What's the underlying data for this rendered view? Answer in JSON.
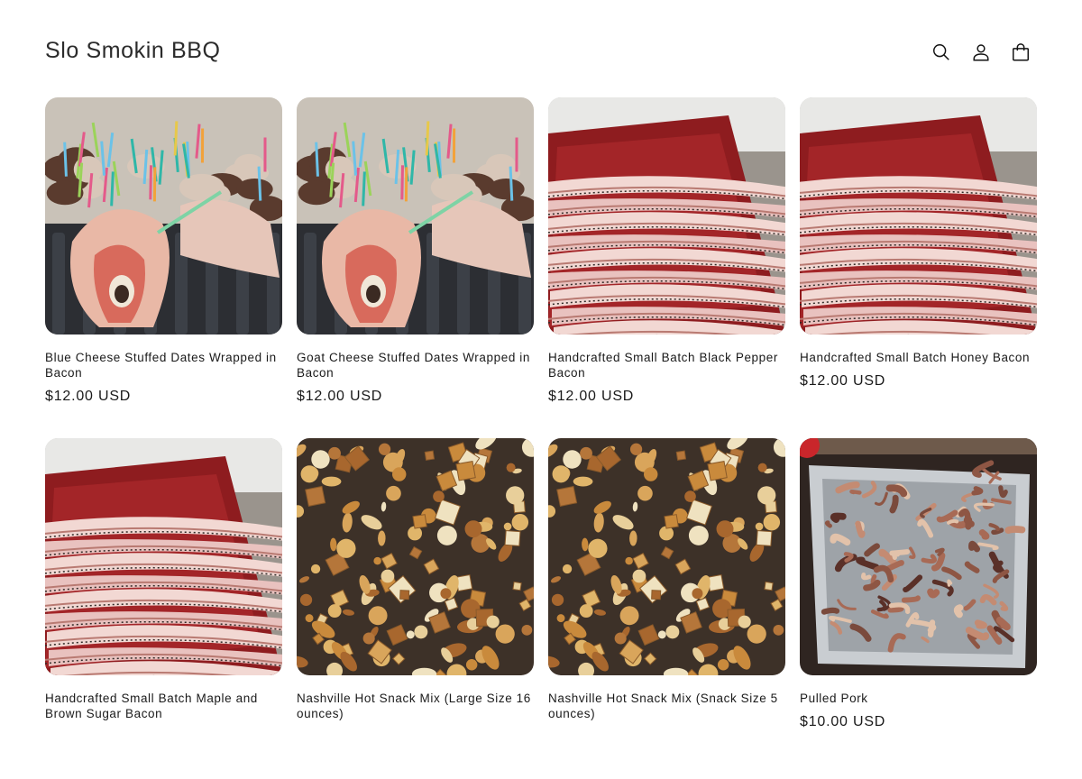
{
  "header": {
    "store_name": "Slo Smokin BBQ",
    "icons": [
      "search-icon",
      "account-icon",
      "cart-icon"
    ]
  },
  "products": [
    {
      "title": "Blue Cheese Stuffed Dates Wrapped in Bacon",
      "price": "$12.00 USD",
      "image": "dates"
    },
    {
      "title": "Goat Cheese Stuffed Dates Wrapped in Bacon",
      "price": "$12.00 USD",
      "image": "dates"
    },
    {
      "title": "Handcrafted Small Batch Black Pepper Bacon",
      "price": "$12.00 USD",
      "image": "bacon"
    },
    {
      "title": "Handcrafted Small Batch Honey Bacon",
      "price": "$12.00 USD",
      "image": "bacon"
    },
    {
      "title": "Handcrafted Small Batch Maple and Brown Sugar Bacon",
      "price": "",
      "image": "bacon"
    },
    {
      "title": "Nashville Hot Snack Mix (Large Size 16 ounces)",
      "price": "",
      "image": "snack"
    },
    {
      "title": "Nashville Hot Snack Mix (Snack Size 5 ounces)",
      "price": "",
      "image": "snack"
    },
    {
      "title": "Pulled Pork",
      "price": "$10.00 USD",
      "image": "pork"
    }
  ]
}
